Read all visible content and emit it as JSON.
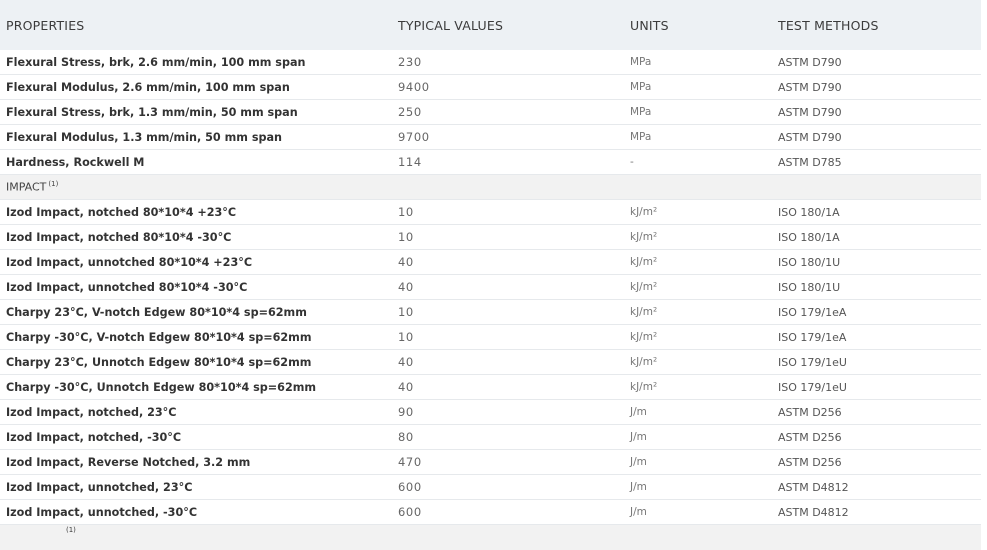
{
  "headers": {
    "properties": "PROPERTIES",
    "typical_values": "TYPICAL VALUES",
    "units": "UNITS",
    "test_methods": "TEST METHODS"
  },
  "rows_top": [
    {
      "property": "Flexural Stress, brk, 2.6 mm/min, 100 mm span",
      "value": "230",
      "unit": "MPa",
      "method": "ASTM D790"
    },
    {
      "property": "Flexural Modulus, 2.6 mm/min, 100 mm span",
      "value": "9400",
      "unit": "MPa",
      "method": "ASTM D790"
    },
    {
      "property": "Flexural Stress, brk, 1.3 mm/min, 50 mm span",
      "value": "250",
      "unit": "MPa",
      "method": "ASTM D790"
    },
    {
      "property": "Flexural Modulus, 1.3 mm/min, 50 mm span",
      "value": "9700",
      "unit": "MPa",
      "method": "ASTM D790"
    },
    {
      "property": "Hardness, Rockwell M",
      "value": "114",
      "unit": "-",
      "method": "ASTM D785"
    }
  ],
  "section": {
    "label": "IMPACT",
    "footnote": "(1)"
  },
  "rows_impact": [
    {
      "property": "Izod Impact, notched 80*10*4 +23°C",
      "value": "10",
      "unit": "kJ/m²",
      "method": "ISO 180/1A"
    },
    {
      "property": "Izod Impact, notched 80*10*4 -30°C",
      "value": "10",
      "unit": "kJ/m²",
      "method": "ISO 180/1A"
    },
    {
      "property": "Izod Impact, unnotched 80*10*4 +23°C",
      "value": "40",
      "unit": "kJ/m²",
      "method": "ISO 180/1U"
    },
    {
      "property": "Izod Impact, unnotched 80*10*4 -30°C",
      "value": "40",
      "unit": "kJ/m²",
      "method": "ISO 180/1U"
    },
    {
      "property": "Charpy 23°C, V-notch Edgew 80*10*4 sp=62mm",
      "value": "10",
      "unit": "kJ/m²",
      "method": "ISO 179/1eA"
    },
    {
      "property": "Charpy -30°C, V-notch Edgew 80*10*4 sp=62mm",
      "value": "10",
      "unit": "kJ/m²",
      "method": "ISO 179/1eA"
    },
    {
      "property": "Charpy 23°C, Unnotch Edgew 80*10*4 sp=62mm",
      "value": "40",
      "unit": "kJ/m²",
      "method": "ISO 179/1eU"
    },
    {
      "property": "Charpy -30°C, Unnotch Edgew 80*10*4 sp=62mm",
      "value": "40",
      "unit": "kJ/m²",
      "method": "ISO 179/1eU"
    },
    {
      "property": "Izod Impact, notched, 23°C",
      "value": "90",
      "unit": "J/m",
      "method": "ASTM D256"
    },
    {
      "property": "Izod Impact, notched, -30°C",
      "value": "80",
      "unit": "J/m",
      "method": "ASTM D256"
    },
    {
      "property": "Izod Impact, Reverse Notched, 3.2 mm",
      "value": "470",
      "unit": "J/m",
      "method": "ASTM D256"
    },
    {
      "property": "Izod Impact, unnotched, 23°C",
      "value": "600",
      "unit": "J/m",
      "method": "ASTM D4812"
    },
    {
      "property": "Izod Impact, unnotched, -30°C",
      "value": "600",
      "unit": "J/m",
      "method": "ASTM D4812"
    }
  ],
  "partial_row": {
    "footnote": "(1)"
  },
  "colors": {
    "header_bg": "#edf1f4",
    "section_bg": "#f2f2f2",
    "row_divider": "#e6e9ec"
  }
}
